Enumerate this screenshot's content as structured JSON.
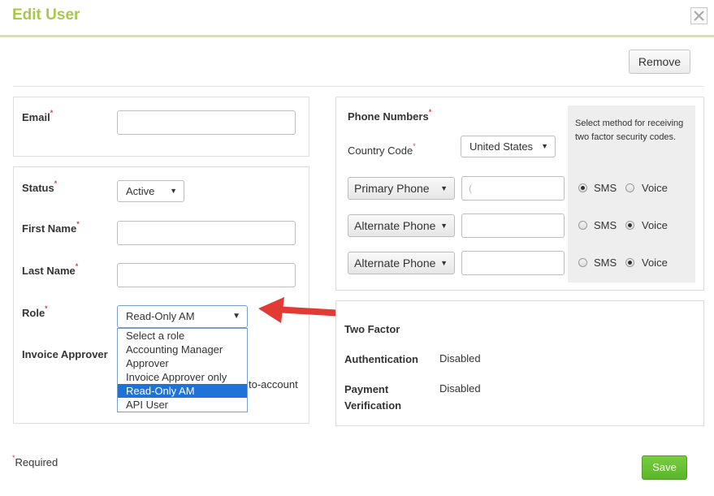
{
  "dialog": {
    "title": "Edit User",
    "remove_label": "Remove",
    "save_label": "Save",
    "required_note": "Required"
  },
  "account_form": {
    "email_label": "Email",
    "email_value": "",
    "status_label": "Status",
    "status_value": "Active",
    "first_name_label": "First Name",
    "first_name_value": "",
    "last_name_label": "Last Name",
    "last_name_value": "",
    "role_label": "Role",
    "role_value": "Read-Only AM",
    "role_options": [
      "Select a role",
      "Accounting Manager",
      "Approver",
      "Invoice Approver only",
      "Read-Only AM",
      "API User"
    ],
    "role_selected_index": 4,
    "invoice_approver_label": "Invoice Approver",
    "obscured_text": "to-account"
  },
  "phone_numbers": {
    "title": "Phone Numbers",
    "country_code_label": "Country Code",
    "country_code_value": "United States",
    "hint": "Select method for receiving two factor security codes.",
    "rows": [
      {
        "type": "Primary Phone",
        "value": "(",
        "sms": "SMS",
        "voice": "Voice",
        "method": "sms"
      },
      {
        "type": "Alternate Phone",
        "value": "",
        "sms": "SMS",
        "voice": "Voice",
        "method": "voice"
      },
      {
        "type": "Alternate Phone",
        "value": "",
        "sms": "SMS",
        "voice": "Voice",
        "method": "voice"
      }
    ]
  },
  "two_factor": {
    "title": "Two Factor",
    "authentication_label": "Authentication",
    "authentication_value": "Disabled",
    "payment_label_line1": "Payment",
    "payment_label_line2": "Verification",
    "payment_value": "Disabled"
  },
  "colors": {
    "title": "#a6c94a",
    "save_button": "#6bc136",
    "annotation_arrow": "#e23b36",
    "selected_option": "#1f72d8",
    "required_star": "#e0423d"
  },
  "icons": {
    "close": "close-icon",
    "caret": "caret-down-icon",
    "arrow": "red-arrow-annotation"
  }
}
